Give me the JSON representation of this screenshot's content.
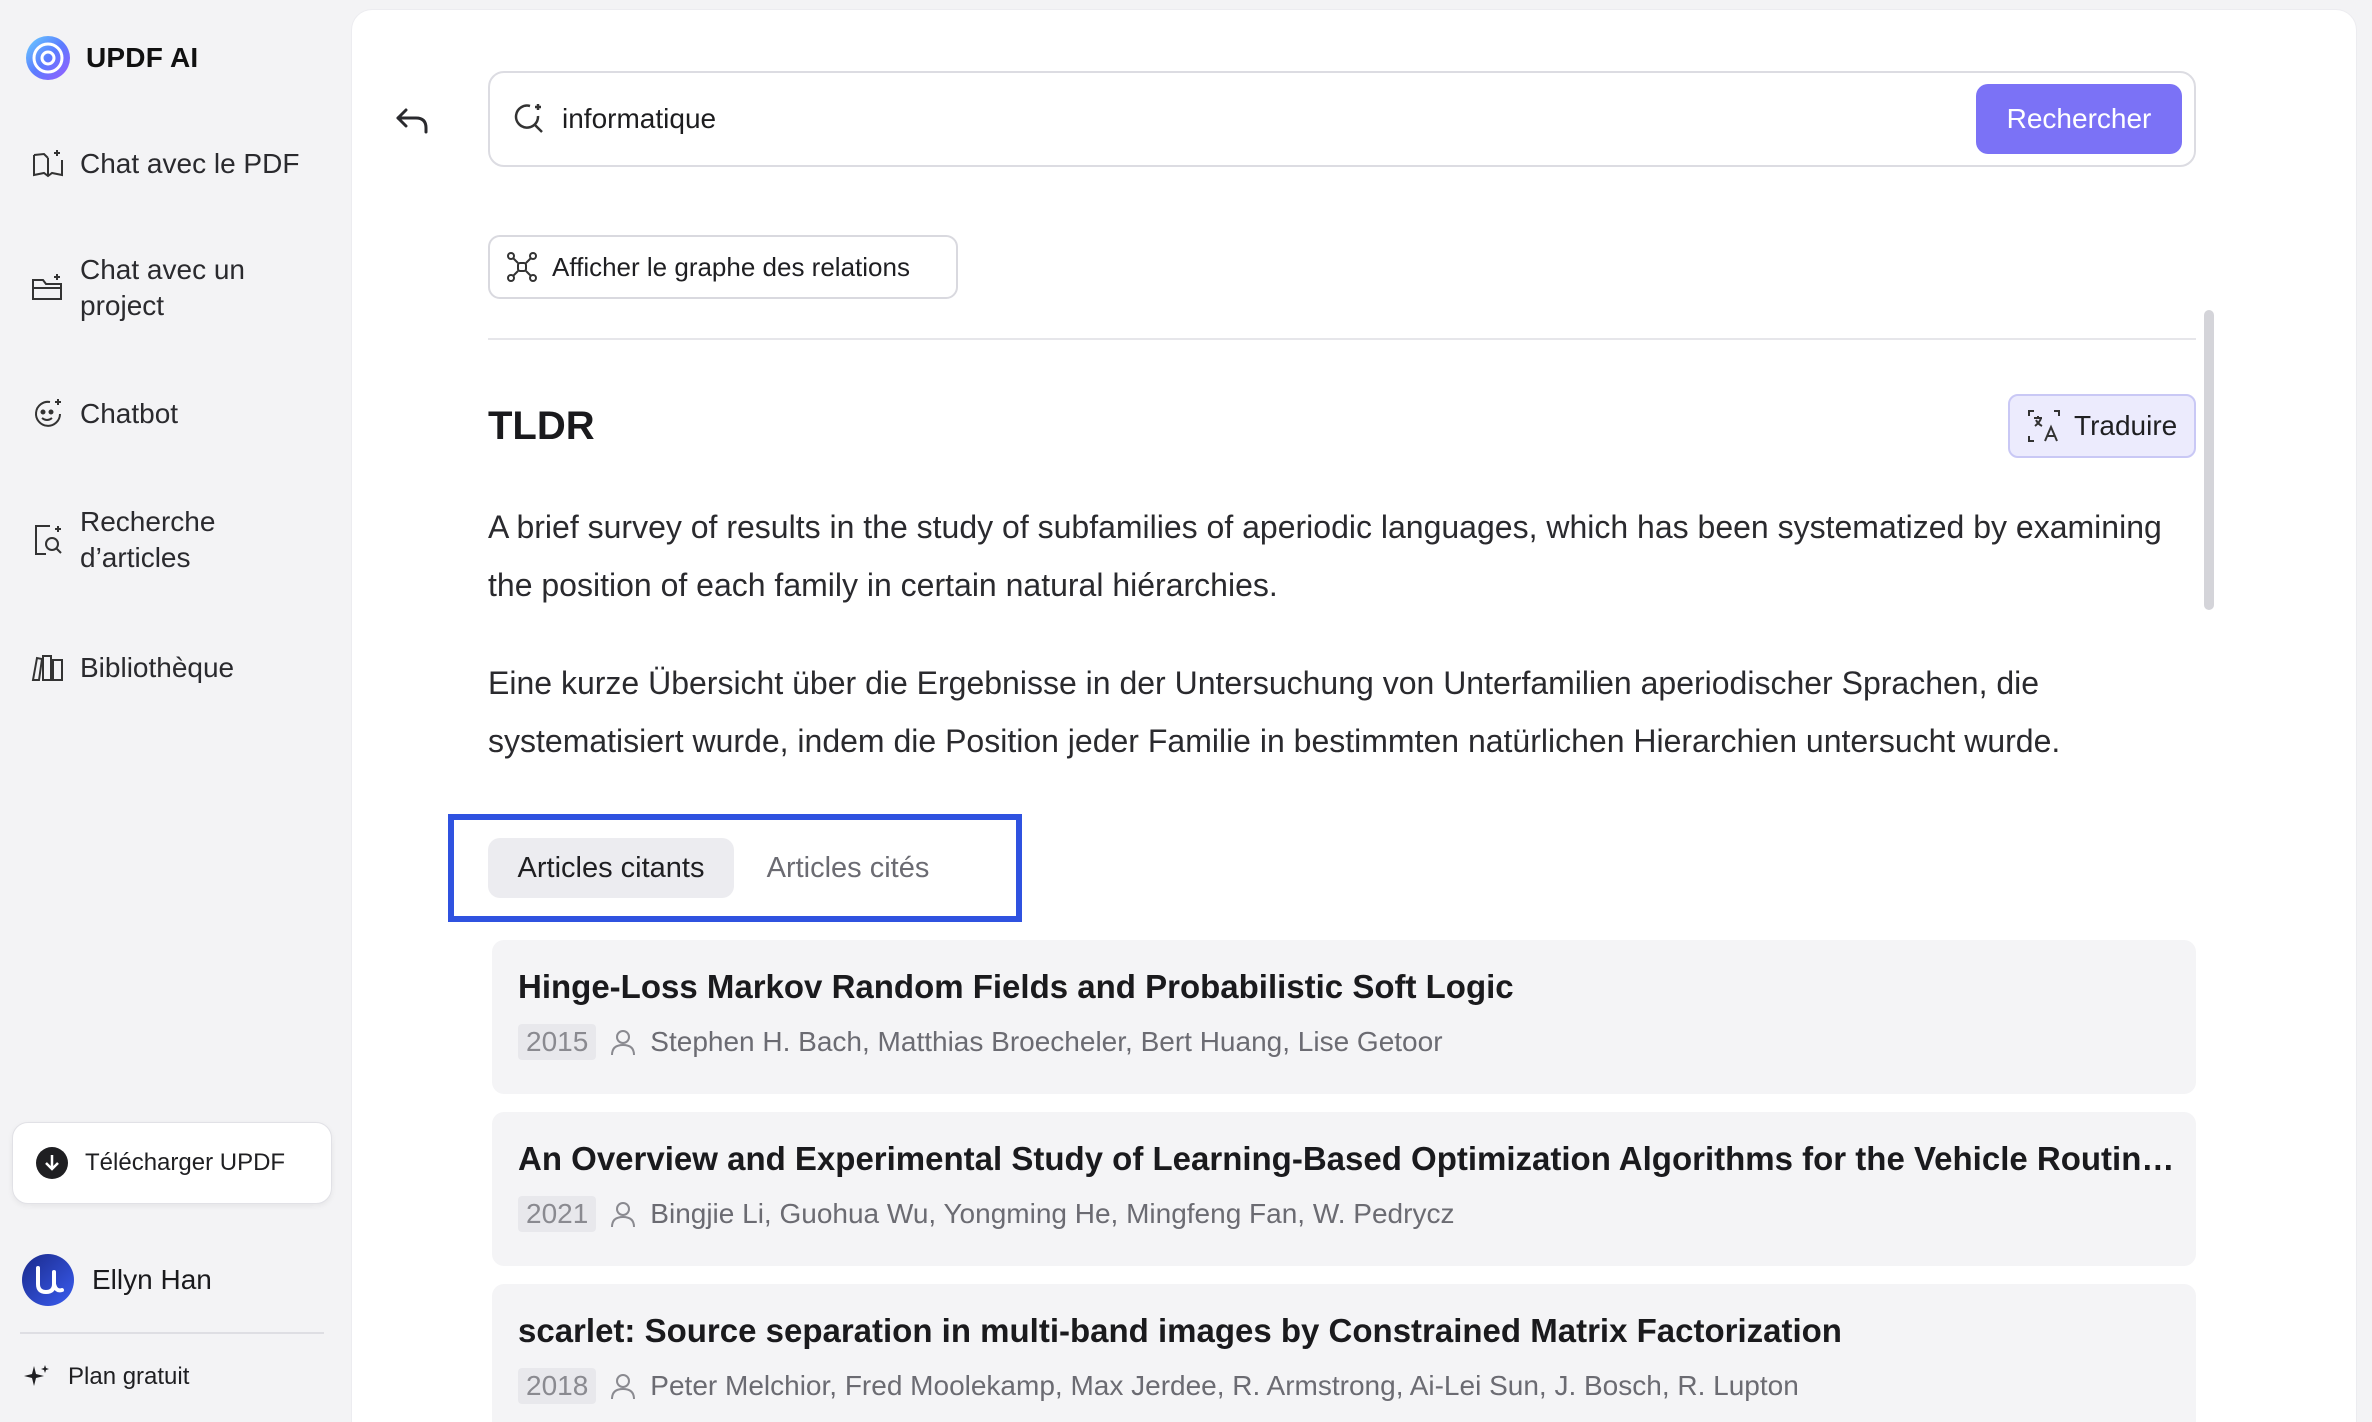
{
  "app": {
    "name": "UPDF AI"
  },
  "sidebar": {
    "items": [
      {
        "label": "Chat avec le PDF",
        "icon": "book-sparkle-icon"
      },
      {
        "label": "Chat avec un\nproject",
        "icon": "folder-sparkle-icon"
      },
      {
        "label": "Chatbot",
        "icon": "bot-face-icon"
      },
      {
        "label": "Recherche\nd’articles",
        "icon": "document-search-icon"
      },
      {
        "label": "Bibliothèque",
        "icon": "library-icon"
      }
    ],
    "download_label": "Télécharger UPDF",
    "user_name": "Ellyn Han",
    "plan_label": "Plan gratuit"
  },
  "search": {
    "value": "informatique",
    "button_label": "Rechercher"
  },
  "graph_button_label": "Afficher le graphe des relations",
  "tldr": {
    "title": "TLDR",
    "translate_label": "Traduire",
    "text_en": "A brief survey of results in the study of subfamilies of aperiodic languages, which has been systematized by examining the position of each family in certain natural hiérarchies.",
    "text_de": "Eine kurze Übersicht über die Ergebnisse in der Untersuchung von Unterfamilien aperiodischer Sprachen, die systematisiert wurde, indem die Position jeder Familie in bestimmten natürlichen Hierarchien untersucht wurde."
  },
  "tabs": [
    {
      "label": "Articles citants",
      "active": true
    },
    {
      "label": "Articles cités",
      "active": false
    }
  ],
  "articles": [
    {
      "title": "Hinge-Loss Markov Random Fields and Probabilistic Soft Logic",
      "year": "2015",
      "authors": "Stephen H. Bach, Matthias Broecheler, Bert Huang, Lise Getoor"
    },
    {
      "title": "An Overview and Experimental Study of Learning-Based Optimization Algorithms for the Vehicle Routing Problem",
      "year": "2021",
      "authors": "Bingjie Li, Guohua Wu, Yongming He, Mingfeng Fan, W. Pedrycz"
    },
    {
      "title": "scarlet: Source separation in multi-band images by Constrained Matrix Factorization",
      "year": "2018",
      "authors": "Peter Melchior, Fred Moolekamp, Max Jerdee, R. Armstrong, Ai-Lei Sun, J. Bosch, R. Lupton"
    }
  ],
  "colors": {
    "accent": "#7b72f6",
    "highlight_border": "#2f52e0",
    "translate_bg": "#ecebfd"
  }
}
